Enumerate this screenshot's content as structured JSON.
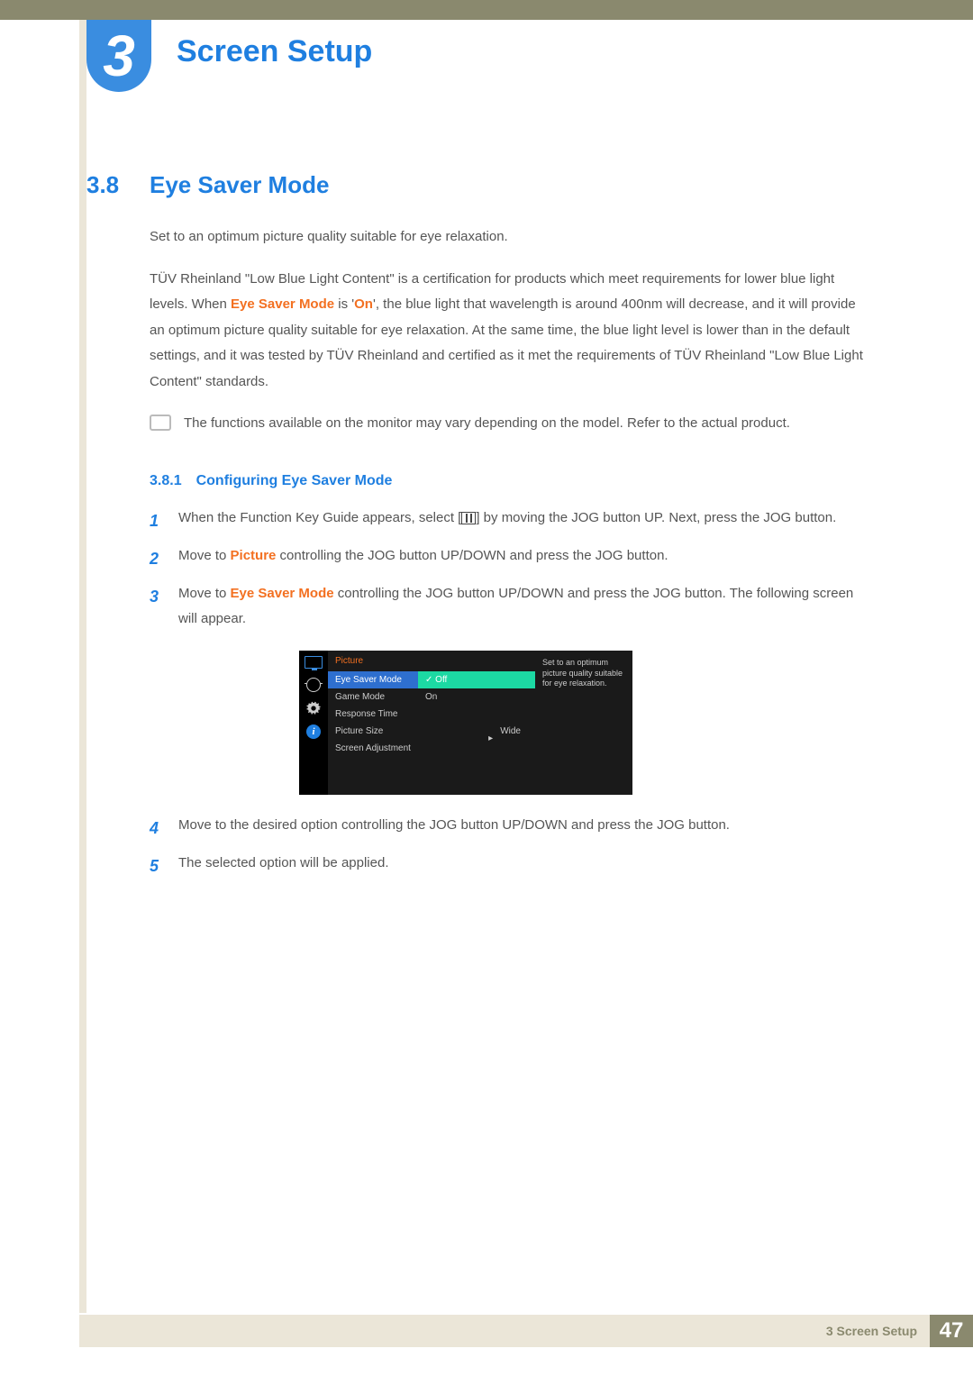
{
  "chapter": {
    "number": "3",
    "title": "Screen Setup"
  },
  "section": {
    "number": "3.8",
    "title": "Eye Saver Mode"
  },
  "intro1": "Set to an optimum picture quality suitable for eye relaxation.",
  "intro2a": "TÜV Rheinland \"Low Blue Light Content\" is a certification for products which meet requirements for lower blue light levels. When ",
  "intro2_term1": "Eye Saver Mode",
  "intro2b": " is '",
  "intro2_term2": "On",
  "intro2c": "', the blue light that wavelength is around 400nm will decrease, and it will provide an optimum picture quality suitable for eye relaxation. At the same time, the blue light level is lower than in the default settings, and it was tested by TÜV Rheinland and certified as it met the requirements of TÜV Rheinland \"Low Blue Light Content\" standards.",
  "note": "The functions available on the monitor may vary depending on the model. Refer to the actual product.",
  "subsection": {
    "number": "3.8.1",
    "title": "Configuring Eye Saver Mode"
  },
  "steps": {
    "s1a": "When the Function Key Guide appears, select [",
    "s1b": "] by moving the JOG button UP. Next, press the JOG button.",
    "s2a": "Move to ",
    "s2_term": "Picture",
    "s2b": " controlling the JOG button UP/DOWN and press the JOG button.",
    "s3a": "Move to ",
    "s3_term": "Eye Saver Mode",
    "s3b": " controlling the JOG button UP/DOWN and press the JOG button. The following screen will appear.",
    "s4": "Move to the desired option controlling the JOG button UP/DOWN and press the JOG button.",
    "s5": "The selected option will be applied."
  },
  "step_nums": {
    "n1": "1",
    "n2": "2",
    "n3": "3",
    "n4": "4",
    "n5": "5"
  },
  "osd": {
    "header": "Picture",
    "items": {
      "eye": "Eye Saver Mode",
      "game": "Game Mode",
      "resp": "Response Time",
      "size": "Picture Size",
      "adj": "Screen Adjustment"
    },
    "values": {
      "off": "Off",
      "on": "On",
      "wide": "Wide"
    },
    "tip": "Set to an optimum picture quality suitable for eye relaxation."
  },
  "footer": {
    "text": "3 Screen Setup",
    "page": "47"
  }
}
